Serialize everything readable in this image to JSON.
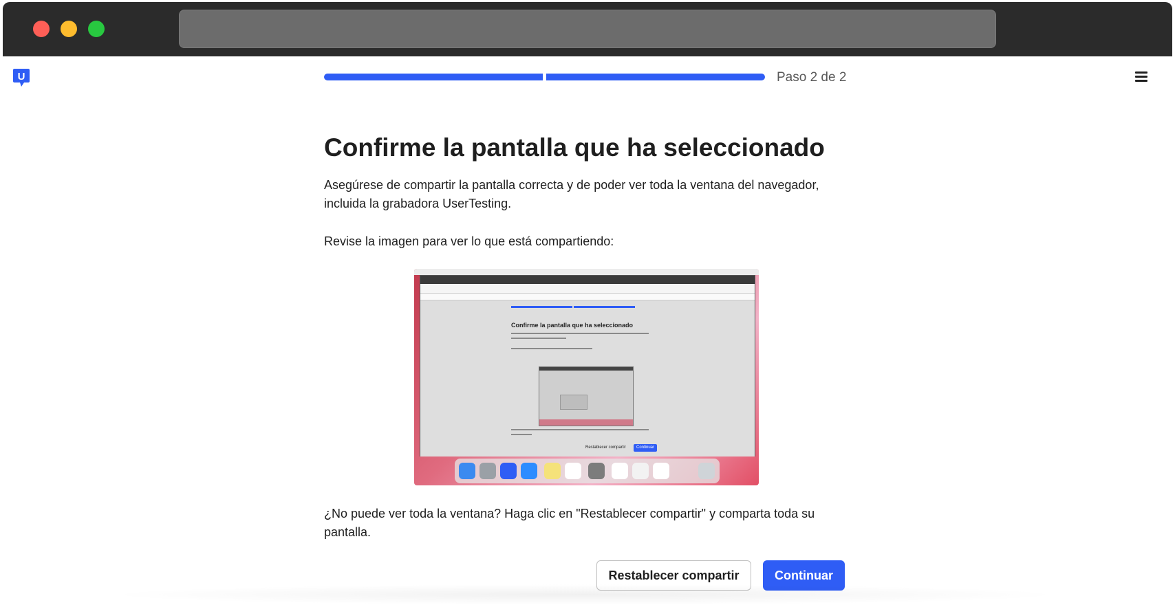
{
  "window": {
    "traffic_lights": [
      "close",
      "minimize",
      "zoom"
    ],
    "address_bar": ""
  },
  "header": {
    "logo_icon": "usertesting-logo-icon",
    "step_text": "Paso 2 de 2",
    "progress": {
      "current_step": 2,
      "total_steps": 2
    },
    "menu_icon": "hamburger-menu-icon"
  },
  "main": {
    "title": "Confirme la pantalla que ha seleccionado",
    "instruction": "Asegúrese de compartir la pantalla correcta y de poder ver toda la ventana del navegador, incluida la grabadora UserTesting.",
    "review_prompt": "Revise la imagen para ver lo que está compartiendo:",
    "help_text": "¿No puede ver toda la ventana? Haga clic en \"Restablecer compartir\" y comparta toda su pantalla."
  },
  "preview": {
    "title": "Confirme la pantalla que ha seleccionado",
    "reset_label": "Restablecer compartir",
    "continue_label": "Continuar"
  },
  "actions": {
    "reset_label": "Restablecer compartir",
    "continue_label": "Continuar"
  },
  "colors": {
    "accent": "#2f5df5",
    "titlebar": "#2b2b2b",
    "text": "#1f1f1f"
  }
}
